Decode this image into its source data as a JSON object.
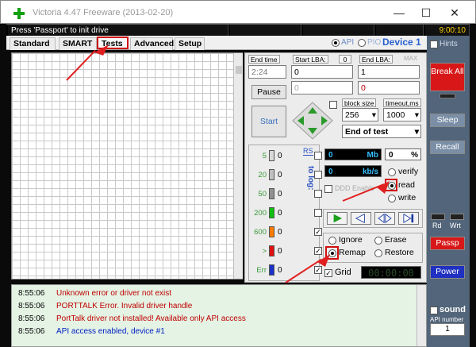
{
  "window": {
    "title": "Victoria 4.47  Freeware (2013-02-20)"
  },
  "status": {
    "message": "Press 'Passport' to init drive",
    "clock": "9:00:10"
  },
  "tabs": [
    "Standard",
    "SMART",
    "Tests",
    "Advanced",
    "Setup"
  ],
  "mode": {
    "api": "API",
    "pio": "PIO",
    "device": "Device 1"
  },
  "hints": "Hints",
  "test": {
    "end_time_label": "End time",
    "end_time": "2:24",
    "start_lba_label": "Start LBA:",
    "start_lba_small": "0",
    "start_lba": "0",
    "end_lba_label": "End LBA:",
    "end_lba_max": "MAX",
    "end_lba": "1",
    "cur_val1": "0",
    "cur_val2": "0",
    "pause": "Pause",
    "start": "Start",
    "block_size_label": "block size",
    "block_size": "256",
    "timeout_label": "timeout,ms",
    "timeout": "1000",
    "end_of_test": "End of test"
  },
  "stats": {
    "rs": "RS",
    "to_log": "to log:",
    "rows": [
      {
        "ms": "5",
        "count": "0",
        "color": "#d9d9d9",
        "log": false
      },
      {
        "ms": "20",
        "count": "0",
        "color": "#c0c0c0",
        "log": false
      },
      {
        "ms": "50",
        "count": "0",
        "color": "#909090",
        "log": false
      },
      {
        "ms": "200",
        "count": "0",
        "color": "#10c010",
        "log": false
      },
      {
        "ms": "600",
        "count": "0",
        "color": "#ff7a00",
        "log": true
      },
      {
        "ms": ">",
        "count": "0",
        "color": "#e01010",
        "log": true
      },
      {
        "ms": "Err",
        "count": "0",
        "color": "#1a30c8",
        "log": true
      }
    ]
  },
  "meters": {
    "mb_val": "0",
    "mb_unit": "Mb",
    "pct_val": "0",
    "pct_unit": "%",
    "speed_val": "0",
    "speed_unit": "kb/s",
    "ddd_enable": "DDD Enable"
  },
  "modes": {
    "verify": "verify",
    "read": "read",
    "write": "write",
    "selected": "read"
  },
  "actions": {
    "ignore": "Ignore",
    "erase": "Erase",
    "remap": "Remap",
    "restore": "Restore",
    "selected": "Remap"
  },
  "grid_toggle": {
    "label": "Grid",
    "timer": "00:00:00"
  },
  "log": [
    {
      "time": "8:55:06",
      "text": "Unknown error or driver not exist",
      "color": "#c00000"
    },
    {
      "time": "8:55:06",
      "text": "PORTTALK Error. Invalid driver handle",
      "color": "#c00000"
    },
    {
      "time": "8:55:06",
      "text": "PortTalk driver not installed! Available only API access",
      "color": "#c00000"
    },
    {
      "time": "8:55:06",
      "text": "API access enabled, device #1",
      "color": "#0020c0"
    }
  ],
  "side": {
    "break_all": "Break All",
    "sleep": "Sleep",
    "recall": "Recall",
    "rd": "Rd",
    "wrt": "Wrt",
    "passp": "Passp",
    "power": "Power",
    "sound": "sound",
    "api_number_label": "API number",
    "api_number": "1"
  }
}
